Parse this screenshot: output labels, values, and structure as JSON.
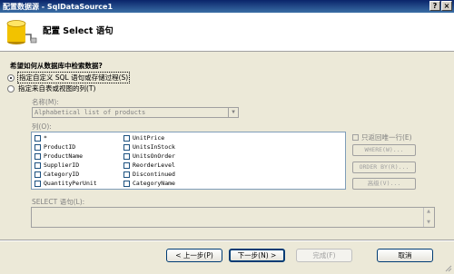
{
  "window": {
    "title": "配置数据源 - SqlDataSource1",
    "help_btn": "?",
    "close_btn": "×"
  },
  "header": {
    "title": "配置 Select 语句"
  },
  "question": "希望如何从数据库中检索数据?",
  "options": [
    {
      "label": "指定自定义 SQL 语句或存储过程(S)",
      "checked": true
    },
    {
      "label": "指定来自表或视图的列(T)",
      "checked": false
    }
  ],
  "name_label": "名称(M):",
  "table_select": {
    "value": "Alphabetical list of products"
  },
  "columns_label": "列(O):",
  "columns": [
    "*",
    "ProductID",
    "ProductName",
    "SupplierID",
    "CategoryID",
    "QuantityPerUnit",
    "UnitPrice",
    "UnitsInStock",
    "UnitsOnOrder",
    "ReorderLevel",
    "Discontinued",
    "CategoryName"
  ],
  "only_unique": "只返回唯一行(E)",
  "side_buttons": {
    "where": "WHERE(W)...",
    "orderby": "ORDER BY(R)...",
    "advanced": "高级(V)..."
  },
  "select_label": "SELECT 语句(L):",
  "nav": {
    "prev": "< 上一步(P)",
    "next": "下一步(N) >",
    "finish": "完成(F)",
    "cancel": "取消"
  },
  "colors": {
    "title_bar": "#0a246a",
    "face": "#ece9d8",
    "border_blue": "#003c74"
  }
}
